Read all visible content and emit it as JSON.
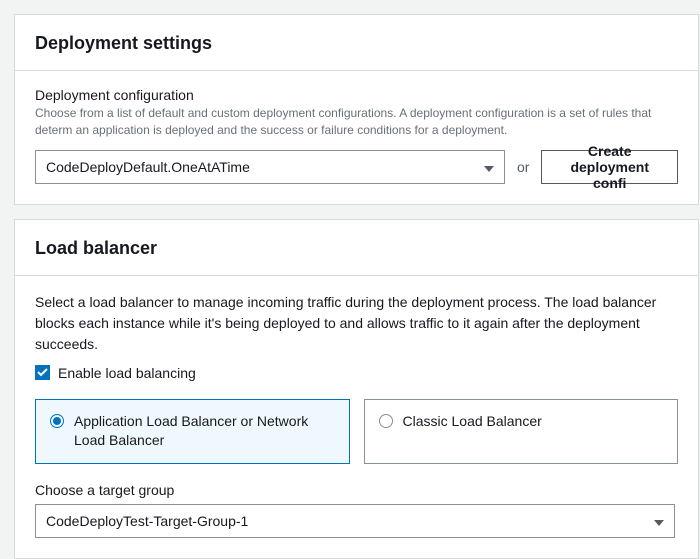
{
  "deployment_settings": {
    "title": "Deployment settings",
    "config_label": "Deployment configuration",
    "config_help": "Choose from a list of default and custom deployment configurations. A deployment configuration is a set of rules that determ an application is deployed and the success or failure conditions for a deployment.",
    "selected_config": "CodeDeployDefault.OneAtATime",
    "or_text": "or",
    "create_button": "Create deployment confi"
  },
  "load_balancer": {
    "title": "Load balancer",
    "description": "Select a load balancer to manage incoming traffic during the deployment process. The load balancer blocks each instance while it's being deployed to and allows traffic to it again after the deployment succeeds.",
    "enable_label": "Enable load balancing",
    "enable_checked": true,
    "options": [
      {
        "label": "Application Load Balancer or Network Load Balancer",
        "selected": true
      },
      {
        "label": "Classic Load Balancer",
        "selected": false
      }
    ],
    "target_group_label": "Choose a target group",
    "selected_target_group": "CodeDeployTest-Target-Group-1"
  }
}
